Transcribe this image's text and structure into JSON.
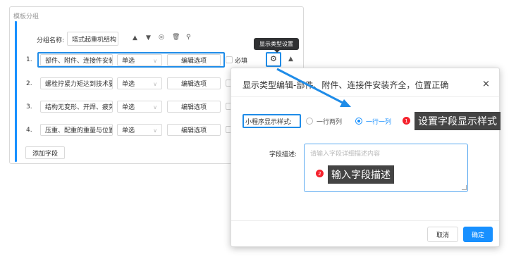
{
  "card": {
    "title": "模板分组"
  },
  "group": {
    "name_label": "分组名称:",
    "name_value": "塔式起重机结构"
  },
  "toolbar": {
    "up": "▲",
    "down": "▼",
    "view": "◎",
    "delete": "🗑",
    "user": "⚲"
  },
  "rows": [
    {
      "index": "1.",
      "field": "部件、附件、连接件安装",
      "type": "单选",
      "edit": "编辑选项",
      "required": "必填"
    },
    {
      "index": "2.",
      "field": "螺栓拧紧力矩达到技术要",
      "type": "单选",
      "edit": "编辑选项"
    },
    {
      "index": "3.",
      "field": "结构无变形、开焊、疲劳",
      "type": "单选",
      "edit": "编辑选项"
    },
    {
      "index": "4.",
      "field": "压重、配重的重量与位置",
      "type": "单选",
      "edit": "编辑选项"
    }
  ],
  "add_field": "添加字段",
  "tooltip": "显示类型设置",
  "dialog": {
    "title": "显示类型编辑-部件、附件、连接件安装齐全，位置正确",
    "close": "×",
    "style_label": "小程序显示样式:",
    "option_two": "一行两列",
    "option_one": "一行一列",
    "selected": "一行一列",
    "desc_label": "字段描述:",
    "desc_placeholder": "请输入字段详细描述内容",
    "cancel": "取消",
    "ok": "确定"
  },
  "annotations": [
    {
      "num": "1",
      "text": "设置字段显示样式"
    },
    {
      "num": "2",
      "text": "输入字段描述"
    }
  ],
  "colors": {
    "primary": "#1890ff",
    "badge": "#f5222d",
    "callout": "#444444"
  }
}
